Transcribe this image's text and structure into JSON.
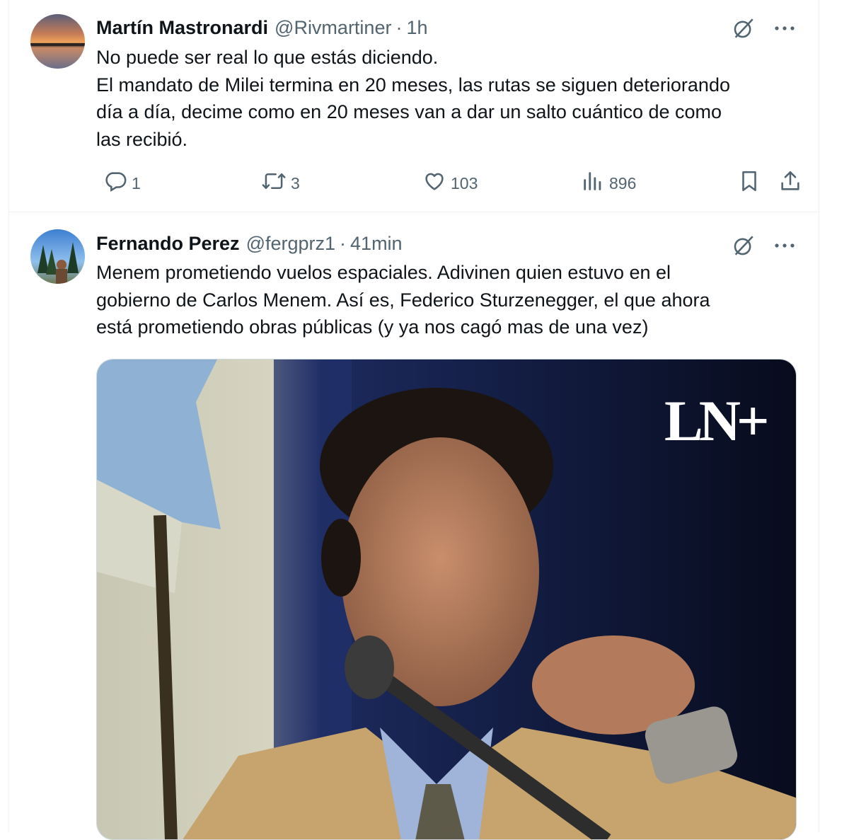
{
  "tweets": [
    {
      "name": "Martín Mastronardi",
      "handle": "@Rivmartiner",
      "separator": "·",
      "time": "1h",
      "lines": [
        "No puede ser real lo que estás diciendo.",
        "El mandato de Milei termina en 20 meses, las rutas se siguen deteriorando",
        "día a día, decime como en 20 meses van a dar un salto cuántico de como",
        "las recibió."
      ],
      "replies": "1",
      "retweets": "3",
      "likes": "103",
      "views": "896"
    },
    {
      "name": "Fernando Perez",
      "handle": "@fergprz1",
      "separator": "·",
      "time": "41min",
      "lines": [
        "Menem prometiendo vuelos espaciales. Adivinen quien estuvo en el",
        "gobierno de Carlos Menem. Así es, Federico Sturzenegger, el que ahora",
        "está prometiendo obras públicas (y ya nos cagó mas de una vez)"
      ],
      "media_watermark": "LN+"
    }
  ],
  "icons": {
    "grok": "grok-icon",
    "more": "more-icon",
    "reply": "reply-icon",
    "retweet": "retweet-icon",
    "like": "like-icon",
    "views": "views-icon",
    "bookmark": "bookmark-icon",
    "share": "share-icon"
  },
  "colors": {
    "text": "#0f1419",
    "secondary": "#536471",
    "border": "#eff3f4"
  }
}
